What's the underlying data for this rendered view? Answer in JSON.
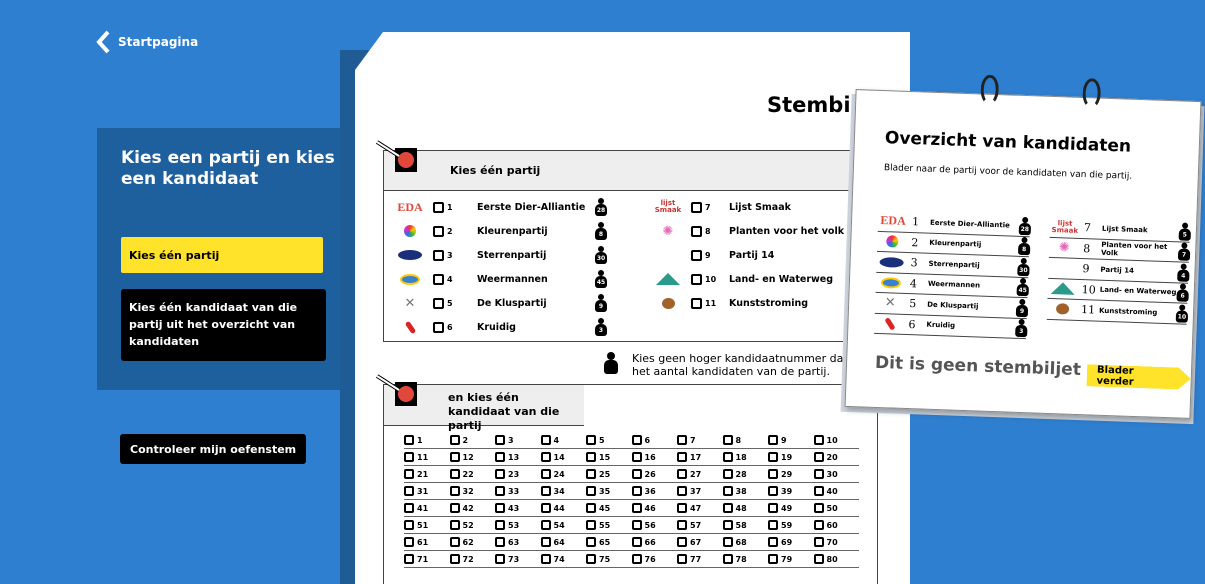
{
  "nav": {
    "back_label": "Startpagina"
  },
  "panel": {
    "heading": "Kies een partij en kies een kandidaat",
    "step1": "Kies één partij",
    "step2": "Kies één kandidaat van die partij uit het overzicht van kandidaten"
  },
  "check_button": "Controleer mijn oefenstem",
  "ballot": {
    "title": "Stembiljet",
    "party_section_heading": "Kies één partij",
    "parties": [
      {
        "num": "1",
        "name": "Eerste Dier-Alliantie",
        "logo": "EDA",
        "count": "28"
      },
      {
        "num": "2",
        "name": "Kleurenpartij",
        "logo": "kleuren",
        "count": "8"
      },
      {
        "num": "3",
        "name": "Sterrenpartij",
        "logo": "sterren",
        "count": "30"
      },
      {
        "num": "4",
        "name": "Weermannen",
        "logo": "weer",
        "count": "45"
      },
      {
        "num": "5",
        "name": "De Kluspartij",
        "logo": "klus",
        "count": "9"
      },
      {
        "num": "6",
        "name": "Kruidig",
        "logo": "kruidig",
        "count": "3"
      },
      {
        "num": "7",
        "name": "Lijst Smaak",
        "logo": "lijst smaak"
      },
      {
        "num": "8",
        "name": "Planten voor het volk",
        "logo": "bloem"
      },
      {
        "num": "9",
        "name": "Partij 14",
        "logo": ""
      },
      {
        "num": "10",
        "name": "Land- en Waterweg",
        "logo": "berg"
      },
      {
        "num": "11",
        "name": "Kunststroming",
        "logo": "palet"
      }
    ],
    "note": "Kies geen hoger kandidaatnummer dan het aantal kandidaten van de partij.",
    "candidate_section_heading": "en kies één kandidaat van die partij",
    "candidate_numbers": [
      "1",
      "2",
      "3",
      "4",
      "5",
      "6",
      "7",
      "8",
      "9",
      "10",
      "11",
      "12",
      "13",
      "14",
      "15",
      "16",
      "17",
      "18",
      "19",
      "20",
      "21",
      "22",
      "23",
      "24",
      "25",
      "26",
      "27",
      "28",
      "29",
      "30",
      "31",
      "32",
      "33",
      "34",
      "35",
      "36",
      "37",
      "38",
      "39",
      "40",
      "41",
      "42",
      "43",
      "44",
      "45",
      "46",
      "47",
      "48",
      "49",
      "50",
      "51",
      "52",
      "53",
      "54",
      "55",
      "56",
      "57",
      "58",
      "59",
      "60",
      "61",
      "62",
      "63",
      "64",
      "65",
      "66",
      "67",
      "68",
      "69",
      "70",
      "71",
      "72",
      "73",
      "74",
      "75",
      "76",
      "77",
      "78",
      "79",
      "80"
    ]
  },
  "overview": {
    "title": "Overzicht van kandidaten",
    "subtitle": "Blader naar de partij voor de kandidaten van die partij.",
    "left": [
      {
        "num": "1",
        "name": "Eerste Dier-Alliantie",
        "count": "28"
      },
      {
        "num": "2",
        "name": "Kleurenpartij",
        "count": "8"
      },
      {
        "num": "3",
        "name": "Sterrenpartij",
        "count": "30"
      },
      {
        "num": "4",
        "name": "Weermannen",
        "count": "45"
      },
      {
        "num": "5",
        "name": "De Kluspartij",
        "count": "9"
      },
      {
        "num": "6",
        "name": "Kruidig",
        "count": "3"
      }
    ],
    "right": [
      {
        "num": "7",
        "name": "Lijst Smaak",
        "count": "5"
      },
      {
        "num": "8",
        "name": "Planten voor het Volk",
        "count": "7"
      },
      {
        "num": "9",
        "name": "Partij 14",
        "count": "4"
      },
      {
        "num": "10",
        "name": "Land- en Waterweg",
        "count": "6"
      },
      {
        "num": "11",
        "name": "Kunststroming",
        "count": "10"
      }
    ],
    "notice": "Dit is geen stembiljet",
    "next_button": "Blader verder"
  },
  "colors": {
    "background": "#2f7fd0",
    "panel": "#1e5f9e",
    "accent": "#ffe22a"
  }
}
